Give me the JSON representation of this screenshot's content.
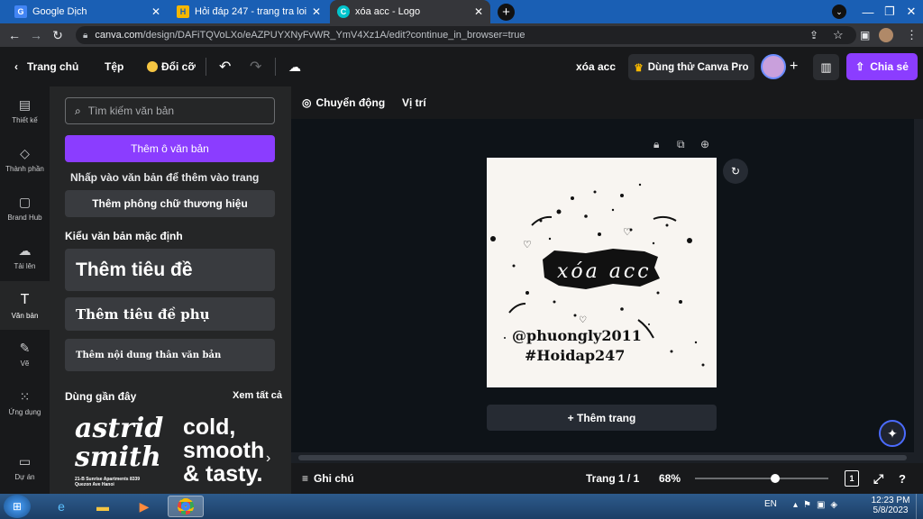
{
  "browser": {
    "tabs": [
      {
        "title": "Google Dịch",
        "icon": "google-translate-icon"
      },
      {
        "title": "Hỏi đáp 247 - trang tra loi",
        "icon": "hoidap-icon"
      },
      {
        "title": "xóa acc - Logo",
        "icon": "canva-icon"
      }
    ],
    "url_domain": "canva.com",
    "url_path": "/design/DAFiTQVoLXo/eAZPUYXNyFvWR_YmV4Xz1A/edit?continue_in_browser=true"
  },
  "canva_header": {
    "home": "Trang chủ",
    "file": "Tệp",
    "resize": "Đổi cỡ",
    "design_title": "xóa acc",
    "pro": "Dùng thử Canva Pro",
    "share": "Chia sẻ"
  },
  "rail": [
    {
      "label": "Thiết kế",
      "icon": "layout-icon"
    },
    {
      "label": "Thành phần",
      "icon": "shapes-icon"
    },
    {
      "label": "Brand Hub",
      "icon": "brand-icon"
    },
    {
      "label": "Tải lên",
      "icon": "upload-icon"
    },
    {
      "label": "Văn bản",
      "icon": "text-icon"
    },
    {
      "label": "Vẽ",
      "icon": "draw-icon"
    },
    {
      "label": "Ứng dụng",
      "icon": "apps-icon"
    },
    {
      "label": "Dự án",
      "icon": "folder-icon"
    }
  ],
  "panel": {
    "search_placeholder": "Tìm kiếm văn bản",
    "add_textbox": "Thêm ô văn bản",
    "hint": "Nhấp vào văn bản để thêm vào trang",
    "brand_fonts": "Thêm phông chữ thương hiệu",
    "default_styles": "Kiểu văn bản mặc định",
    "heading": "Thêm tiêu đề",
    "subheading": "Thêm tiêu đề phụ",
    "body": "Thêm nội dung thân văn bản",
    "recent": "Dùng gần đây",
    "see_all": "Xem tất cả",
    "recent1_l1": "astrid",
    "recent1_l2": "smith",
    "recent1_small": "21-B Sunrise Apartments 8339 Quezon Ave Hanoi",
    "recent2_l1": "cold,",
    "recent2_l2": "smooth",
    "recent2_l3": "& tasty."
  },
  "toolbar": {
    "animate": "Chuyển động",
    "position": "Vị trí"
  },
  "design": {
    "brush_text": "xóa acc",
    "handle": "@phuongly2011",
    "tag": "#Hoidap247"
  },
  "add_page": "+ Thêm trang",
  "bottom": {
    "notes": "Ghi chú",
    "page": "Trang 1 / 1",
    "zoom": "68%",
    "zoom_level": 0.68,
    "page_count": "1"
  },
  "taskbar": {
    "lang": "EN",
    "time": "12:23 PM",
    "date": "5/8/2023"
  },
  "colors": {
    "accent": "#8b3dff",
    "tabbar": "#1a5fb4"
  }
}
